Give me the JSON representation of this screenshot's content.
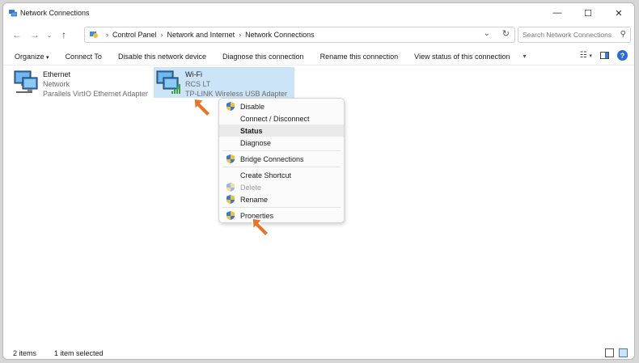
{
  "window": {
    "title": "Network Connections",
    "minimize": "—",
    "maximize": "☐",
    "close": "✕"
  },
  "address": {
    "crumbs": [
      "Control Panel",
      "Network and Internet",
      "Network Connections"
    ],
    "search_placeholder": "Search Network Connections"
  },
  "commands": {
    "organize": "Organize",
    "connect_to": "Connect To",
    "disable_device": "Disable this network device",
    "diagnose_connection": "Diagnose this connection",
    "rename_connection": "Rename this connection",
    "view_status": "View status of this connection"
  },
  "connections": [
    {
      "name": "Ethernet",
      "status": "Network",
      "adapter": "Parallels VirtIO Ethernet Adapter"
    },
    {
      "name": "Wi-Fi",
      "status": "RCS LT",
      "adapter": "TP-LINK Wireless USB Adapter"
    }
  ],
  "context_menu": {
    "disable": "Disable",
    "connect_disconnect": "Connect / Disconnect",
    "status": "Status",
    "diagnose": "Diagnose",
    "bridge": "Bridge Connections",
    "shortcut": "Create Shortcut",
    "delete": "Delete",
    "rename": "Rename",
    "properties": "Properties"
  },
  "status": {
    "items": "2 items",
    "selected": "1 item selected"
  },
  "colors": {
    "selection": "#cce4f7",
    "accent": "#2b6cd6",
    "arrow": "#e8742c"
  }
}
